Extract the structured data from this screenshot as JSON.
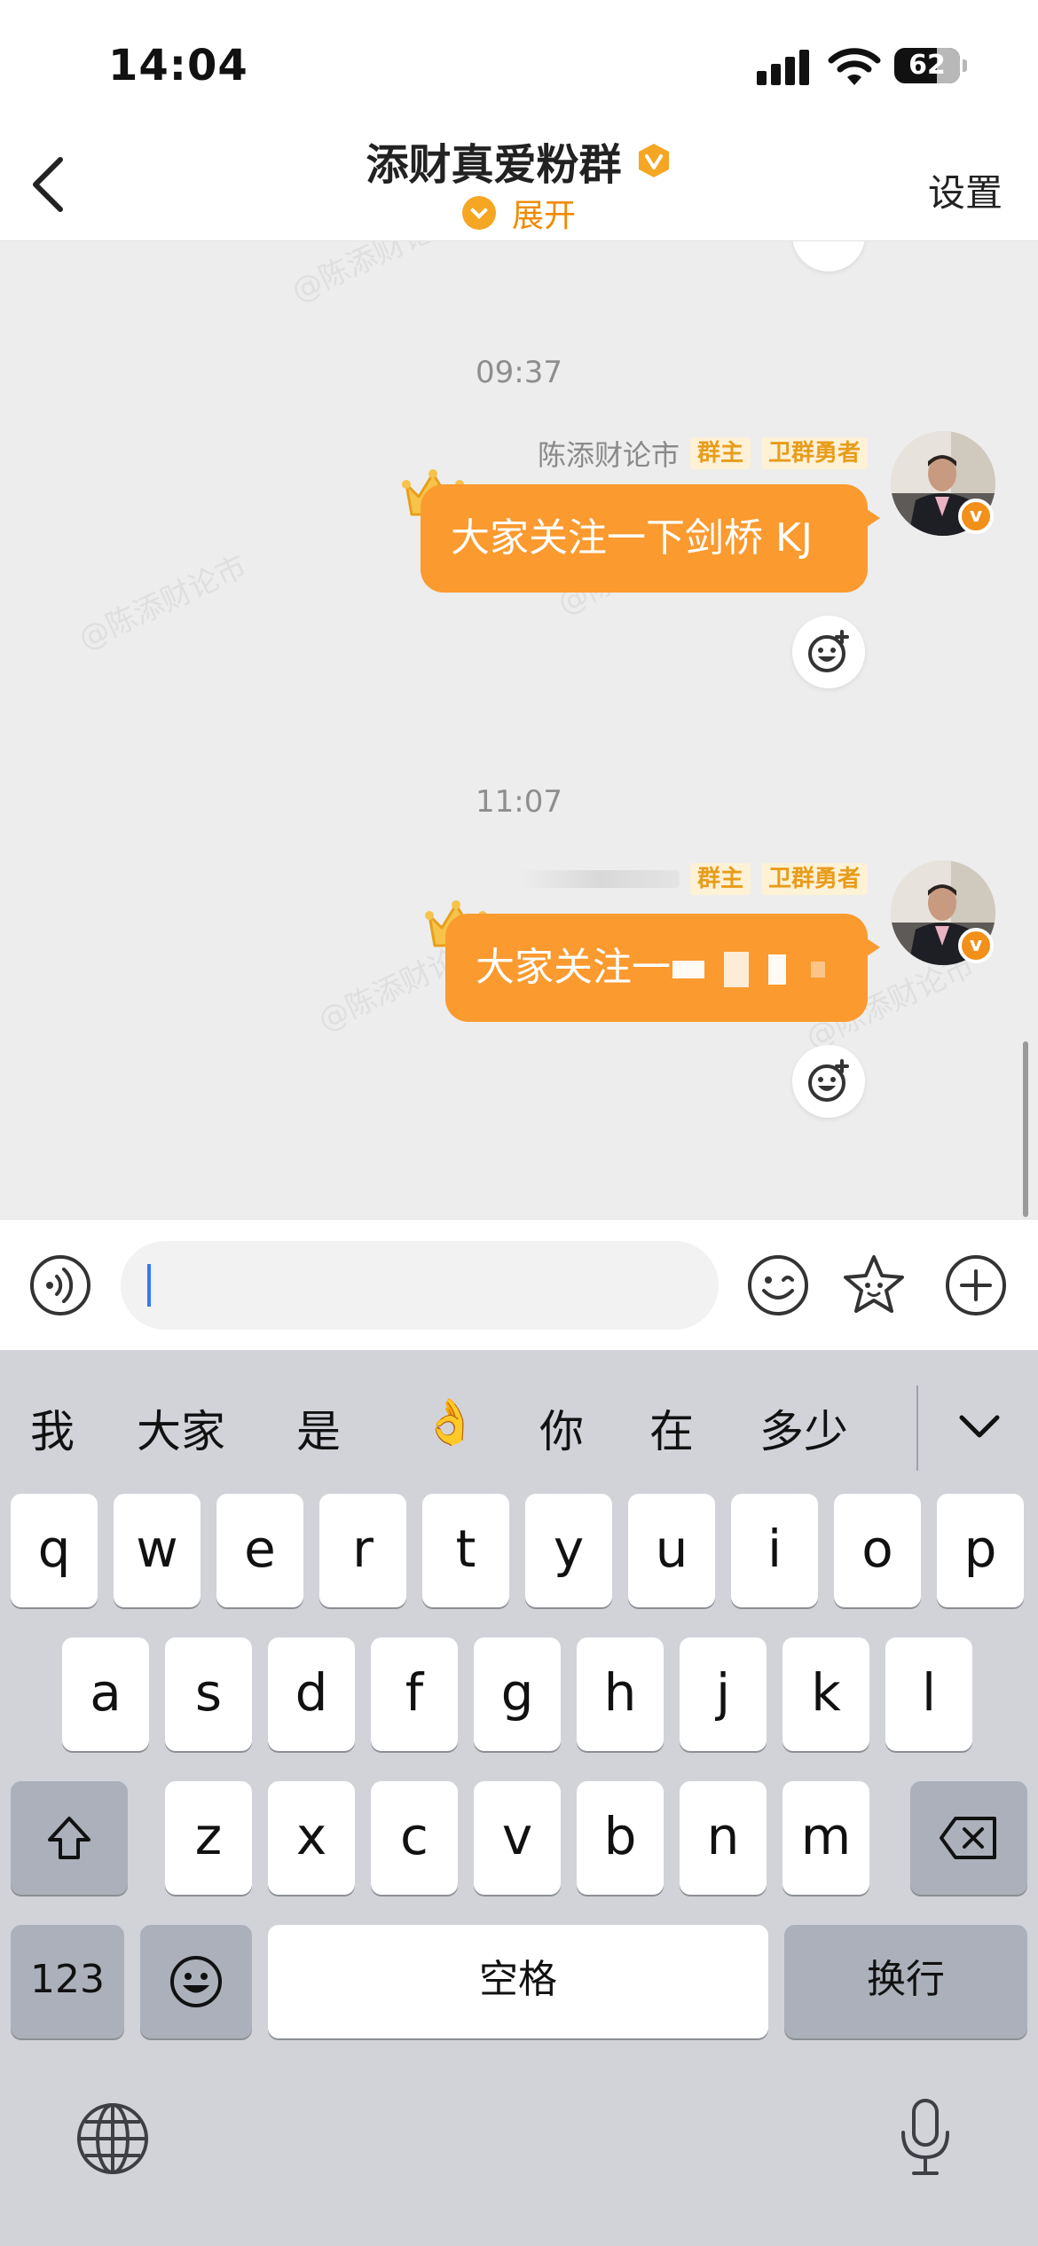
{
  "status_bar": {
    "time": "14:04",
    "battery": "62"
  },
  "header": {
    "title": "添财真爱粉群",
    "expand_label": "展开",
    "settings_label": "设置"
  },
  "watermark": "@陈添财论市",
  "messages": [
    {
      "timestamp": "09:37",
      "sender_name": "陈添财论市",
      "tags": [
        "群主",
        "卫群勇者"
      ],
      "text": "大家关注一下剑桥 KJ"
    },
    {
      "timestamp": "11:07",
      "sender_name": "",
      "tags": [
        "群主",
        "卫群勇者"
      ],
      "text": "大家关注一"
    }
  ],
  "input": {
    "placeholder": ""
  },
  "keyboard": {
    "candidates": [
      "我",
      "大家",
      "是",
      "👌",
      "你",
      "在",
      "多少"
    ],
    "row1": [
      "q",
      "w",
      "e",
      "r",
      "t",
      "y",
      "u",
      "i",
      "o",
      "p"
    ],
    "row2": [
      "a",
      "s",
      "d",
      "f",
      "g",
      "h",
      "j",
      "k",
      "l"
    ],
    "row3": [
      "z",
      "x",
      "c",
      "v",
      "b",
      "n",
      "m"
    ],
    "numbers_label": "123",
    "space_label": "空格",
    "return_label": "换行"
  },
  "colors": {
    "accent": "#fa9a2f",
    "tag_text": "#e79c1b",
    "cursor": "#3478f6"
  },
  "icons": [
    "back-icon",
    "verified-badge-icon",
    "expand-icon",
    "add-reaction-icon",
    "voice-icon",
    "emoji-icon",
    "sticker-star-icon",
    "plus-icon",
    "shift-icon",
    "delete-icon",
    "emoji-key-icon",
    "globe-icon",
    "mic-icon",
    "chevron-down-icon"
  ]
}
